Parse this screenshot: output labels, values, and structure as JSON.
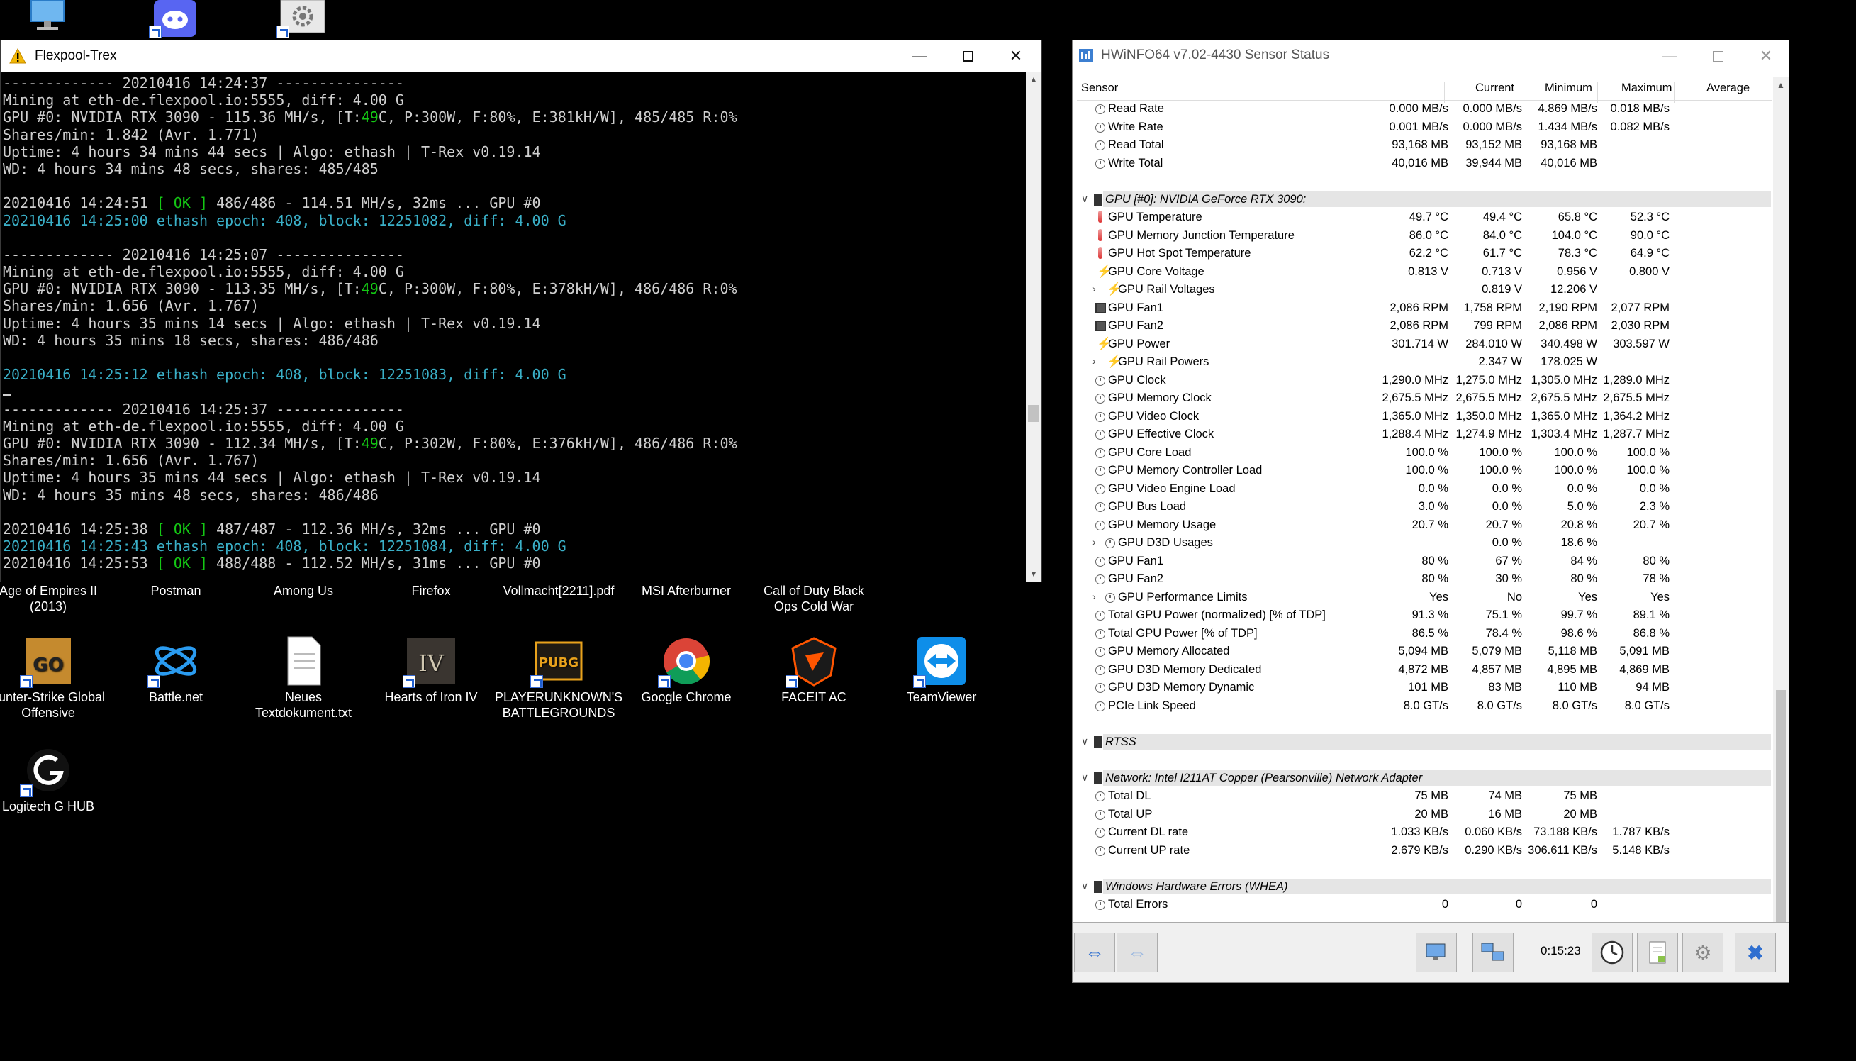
{
  "desktop": {
    "top_icons": [
      {
        "name": "this-pc",
        "icon": "monitor-icon"
      },
      {
        "name": "discord",
        "icon": "discord-icon"
      },
      {
        "name": "settings",
        "icon": "gear-icon"
      }
    ],
    "row1_labels": [
      "Age of Empires II\n(2013)",
      "Postman",
      "Among Us",
      "Firefox",
      "Vollmacht[2211].pdf",
      "MSI Afterburner",
      "Call of Duty Black\nOps Cold War"
    ],
    "row2": [
      {
        "label": "ounter-Strike Global\nOffensive",
        "icon": "csgo-icon"
      },
      {
        "label": "Battle.net",
        "icon": "battlenet-icon"
      },
      {
        "label": "Neues\nTextdokument.txt",
        "icon": "text-document-icon"
      },
      {
        "label": "Hearts of Iron IV",
        "icon": "hoi4-icon"
      },
      {
        "label": "PLAYERUNKNOWN'S\nBATTLEGROUNDS",
        "icon": "pubg-icon"
      },
      {
        "label": "Google Chrome",
        "icon": "chrome-icon"
      },
      {
        "label": "FACEIT AC",
        "icon": "faceit-icon"
      },
      {
        "label": "TeamViewer",
        "icon": "teamviewer-icon"
      }
    ],
    "row3": [
      {
        "label": "Logitech G HUB",
        "icon": "logitech-icon"
      }
    ]
  },
  "console": {
    "title": "Flexpool-Trex",
    "lines": [
      [
        {
          "t": "------------- 20210416 14:24:37 ---------------"
        }
      ],
      [
        {
          "t": "Mining at eth-de.flexpool.io:5555, diff: 4.00 G"
        }
      ],
      [
        {
          "t": "GPU #0: NVIDIA RTX 3090 - 115.36 MH/s, [T:"
        },
        {
          "t": "49",
          "c": "temp"
        },
        {
          "t": "C, P:300W, F:80%, E:381kH/W], 485/485 R:0%"
        }
      ],
      [
        {
          "t": "Shares/min: 1.842 (Avr. 1.771)"
        }
      ],
      [
        {
          "t": "Uptime: 4 hours 34 mins 44 secs | Algo: ethash | T-Rex v0.19.14"
        }
      ],
      [
        {
          "t": "WD: 4 hours 34 mins 48 secs, shares: 485/485"
        }
      ],
      [
        {
          "t": ""
        }
      ],
      [
        {
          "t": "20210416 14:24:51 "
        },
        {
          "t": "[ OK ]",
          "c": "ok"
        },
        {
          "t": " 486/486 - 114.51 MH/s, 32ms ... GPU #0"
        }
      ],
      [
        {
          "t": "20210416 14:25:00 ethash epoch: 408, block: 12251082, diff: 4.00 G",
          "c": "cyan"
        }
      ],
      [
        {
          "t": ""
        }
      ],
      [
        {
          "t": "------------- 20210416 14:25:07 ---------------"
        }
      ],
      [
        {
          "t": "Mining at eth-de.flexpool.io:5555, diff: 4.00 G"
        }
      ],
      [
        {
          "t": "GPU #0: NVIDIA RTX 3090 - 113.35 MH/s, [T:"
        },
        {
          "t": "49",
          "c": "temp"
        },
        {
          "t": "C, P:300W, F:80%, E:378kH/W], 486/486 R:0%"
        }
      ],
      [
        {
          "t": "Shares/min: 1.656 (Avr. 1.767)"
        }
      ],
      [
        {
          "t": "Uptime: 4 hours 35 mins 14 secs | Algo: ethash | T-Rex v0.19.14"
        }
      ],
      [
        {
          "t": "WD: 4 hours 35 mins 18 secs, shares: 486/486"
        }
      ],
      [
        {
          "t": ""
        }
      ],
      [
        {
          "t": "20210416 14:25:12 ethash epoch: 408, block: 12251083, diff: 4.00 G",
          "c": "cyan"
        }
      ],
      [
        {
          "t": "",
          "c": "cursor"
        }
      ],
      [
        {
          "t": "------------- 20210416 14:25:37 ---------------"
        }
      ],
      [
        {
          "t": "Mining at eth-de.flexpool.io:5555, diff: 4.00 G"
        }
      ],
      [
        {
          "t": "GPU #0: NVIDIA RTX 3090 - 112.34 MH/s, [T:"
        },
        {
          "t": "49",
          "c": "temp"
        },
        {
          "t": "C, P:302W, F:80%, E:376kH/W], 486/486 R:0%"
        }
      ],
      [
        {
          "t": "Shares/min: 1.656 (Avr. 1.767)"
        }
      ],
      [
        {
          "t": "Uptime: 4 hours 35 mins 44 secs | Algo: ethash | T-Rex v0.19.14"
        }
      ],
      [
        {
          "t": "WD: 4 hours 35 mins 48 secs, shares: 486/486"
        }
      ],
      [
        {
          "t": ""
        }
      ],
      [
        {
          "t": "20210416 14:25:38 "
        },
        {
          "t": "[ OK ]",
          "c": "ok"
        },
        {
          "t": " 487/487 - 112.36 MH/s, 32ms ... GPU #0"
        }
      ],
      [
        {
          "t": "20210416 14:25:43 ethash epoch: 408, block: 12251084, diff: 4.00 G",
          "c": "cyan"
        }
      ],
      [
        {
          "t": "20210416 14:25:53 "
        },
        {
          "t": "[ OK ]",
          "c": "ok"
        },
        {
          "t": " 488/488 - 112.52 MH/s, 31ms ... GPU #0"
        }
      ],
      [
        {
          "t": "",
          "c": "cursor"
        }
      ]
    ]
  },
  "hwinfo": {
    "title": "HWiNFO64 v7.02-4430 Sensor Status",
    "columns": [
      "Sensor",
      "Current",
      "Minimum",
      "Maximum",
      "Average"
    ],
    "time": "0:15:23",
    "rows": [
      {
        "type": "item",
        "icon": "round",
        "name": "Read Rate",
        "cur": "0.000 MB/s",
        "min": "0.000 MB/s",
        "max": "4.869 MB/s",
        "avg": "0.018 MB/s"
      },
      {
        "type": "item",
        "icon": "round",
        "name": "Write Rate",
        "cur": "0.001 MB/s",
        "min": "0.000 MB/s",
        "max": "1.434 MB/s",
        "avg": "0.082 MB/s"
      },
      {
        "type": "item",
        "icon": "round",
        "name": "Read Total",
        "cur": "93,168 MB",
        "min": "93,152 MB",
        "max": "93,168 MB",
        "avg": ""
      },
      {
        "type": "item",
        "icon": "round",
        "name": "Write Total",
        "cur": "40,016 MB",
        "min": "39,944 MB",
        "max": "40,016 MB",
        "avg": ""
      },
      {
        "type": "blank"
      },
      {
        "type": "group",
        "name": "GPU [#0]: NVIDIA GeForce RTX 3090:"
      },
      {
        "type": "item",
        "icon": "therm",
        "name": "GPU Temperature",
        "cur": "49.7 °C",
        "min": "49.4 °C",
        "max": "65.8 °C",
        "avg": "52.3 °C"
      },
      {
        "type": "item",
        "icon": "therm",
        "name": "GPU Memory Junction Temperature",
        "cur": "86.0 °C",
        "min": "84.0 °C",
        "max": "104.0 °C",
        "avg": "90.0 °C"
      },
      {
        "type": "item",
        "icon": "therm",
        "name": "GPU Hot Spot Temperature",
        "cur": "62.2 °C",
        "min": "61.7 °C",
        "max": "78.3 °C",
        "avg": "64.9 °C"
      },
      {
        "type": "item",
        "icon": "bolt",
        "name": "GPU Core Voltage",
        "cur": "0.813 V",
        "min": "0.713 V",
        "max": "0.956 V",
        "avg": "0.800 V"
      },
      {
        "type": "sub",
        "icon": "bolt",
        "name": "GPU Rail Voltages",
        "cur": "",
        "min": "0.819 V",
        "max": "12.206 V",
        "avg": ""
      },
      {
        "type": "item",
        "icon": "fan",
        "name": "GPU Fan1",
        "cur": "2,086 RPM",
        "min": "1,758 RPM",
        "max": "2,190 RPM",
        "avg": "2,077 RPM"
      },
      {
        "type": "item",
        "icon": "fan",
        "name": "GPU Fan2",
        "cur": "2,086 RPM",
        "min": "799 RPM",
        "max": "2,086 RPM",
        "avg": "2,030 RPM"
      },
      {
        "type": "item",
        "icon": "bolt",
        "name": "GPU Power",
        "cur": "301.714 W",
        "min": "284.010 W",
        "max": "340.498 W",
        "avg": "303.597 W"
      },
      {
        "type": "sub",
        "icon": "bolt",
        "name": "GPU Rail Powers",
        "cur": "",
        "min": "2.347 W",
        "max": "178.025 W",
        "avg": ""
      },
      {
        "type": "item",
        "icon": "round",
        "name": "GPU Clock",
        "cur": "1,290.0 MHz",
        "min": "1,275.0 MHz",
        "max": "1,305.0 MHz",
        "avg": "1,289.0 MHz"
      },
      {
        "type": "item",
        "icon": "round",
        "name": "GPU Memory Clock",
        "cur": "2,675.5 MHz",
        "min": "2,675.5 MHz",
        "max": "2,675.5 MHz",
        "avg": "2,675.5 MHz"
      },
      {
        "type": "item",
        "icon": "round",
        "name": "GPU Video Clock",
        "cur": "1,365.0 MHz",
        "min": "1,350.0 MHz",
        "max": "1,365.0 MHz",
        "avg": "1,364.2 MHz"
      },
      {
        "type": "item",
        "icon": "round",
        "name": "GPU Effective Clock",
        "cur": "1,288.4 MHz",
        "min": "1,274.9 MHz",
        "max": "1,303.4 MHz",
        "avg": "1,287.7 MHz"
      },
      {
        "type": "item",
        "icon": "round",
        "name": "GPU Core Load",
        "cur": "100.0 %",
        "min": "100.0 %",
        "max": "100.0 %",
        "avg": "100.0 %"
      },
      {
        "type": "item",
        "icon": "round",
        "name": "GPU Memory Controller Load",
        "cur": "100.0 %",
        "min": "100.0 %",
        "max": "100.0 %",
        "avg": "100.0 %"
      },
      {
        "type": "item",
        "icon": "round",
        "name": "GPU Video Engine Load",
        "cur": "0.0 %",
        "min": "0.0 %",
        "max": "0.0 %",
        "avg": "0.0 %"
      },
      {
        "type": "item",
        "icon": "round",
        "name": "GPU Bus Load",
        "cur": "3.0 %",
        "min": "0.0 %",
        "max": "5.0 %",
        "avg": "2.3 %"
      },
      {
        "type": "item",
        "icon": "round",
        "name": "GPU Memory Usage",
        "cur": "20.7 %",
        "min": "20.7 %",
        "max": "20.8 %",
        "avg": "20.7 %"
      },
      {
        "type": "sub",
        "icon": "round",
        "name": "GPU D3D Usages",
        "cur": "",
        "min": "0.0 %",
        "max": "18.6 %",
        "avg": ""
      },
      {
        "type": "item",
        "icon": "round",
        "name": "GPU Fan1",
        "cur": "80 %",
        "min": "67 %",
        "max": "84 %",
        "avg": "80 %"
      },
      {
        "type": "item",
        "icon": "round",
        "name": "GPU Fan2",
        "cur": "80 %",
        "min": "30 %",
        "max": "80 %",
        "avg": "78 %"
      },
      {
        "type": "sub",
        "icon": "round",
        "name": "GPU Performance Limits",
        "cur": "Yes",
        "min": "No",
        "max": "Yes",
        "avg": "Yes"
      },
      {
        "type": "item",
        "icon": "round",
        "name": "Total GPU Power (normalized) [% of TDP]",
        "cur": "91.3 %",
        "min": "75.1 %",
        "max": "99.7 %",
        "avg": "89.1 %"
      },
      {
        "type": "item",
        "icon": "round",
        "name": "Total GPU Power [% of TDP]",
        "cur": "86.5 %",
        "min": "78.4 %",
        "max": "98.6 %",
        "avg": "86.8 %"
      },
      {
        "type": "item",
        "icon": "round",
        "name": "GPU Memory Allocated",
        "cur": "5,094 MB",
        "min": "5,079 MB",
        "max": "5,118 MB",
        "avg": "5,091 MB"
      },
      {
        "type": "item",
        "icon": "round",
        "name": "GPU D3D Memory Dedicated",
        "cur": "4,872 MB",
        "min": "4,857 MB",
        "max": "4,895 MB",
        "avg": "4,869 MB"
      },
      {
        "type": "item",
        "icon": "round",
        "name": "GPU D3D Memory Dynamic",
        "cur": "101 MB",
        "min": "83 MB",
        "max": "110 MB",
        "avg": "94 MB"
      },
      {
        "type": "item",
        "icon": "round",
        "name": "PCIe Link Speed",
        "cur": "8.0 GT/s",
        "min": "8.0 GT/s",
        "max": "8.0 GT/s",
        "avg": "8.0 GT/s"
      },
      {
        "type": "blank"
      },
      {
        "type": "group",
        "name": "RTSS"
      },
      {
        "type": "blank"
      },
      {
        "type": "group",
        "name": "Network: Intel I211AT Copper (Pearsonville) Network Adapter"
      },
      {
        "type": "item",
        "icon": "round",
        "name": "Total DL",
        "cur": "75 MB",
        "min": "74 MB",
        "max": "75 MB",
        "avg": ""
      },
      {
        "type": "item",
        "icon": "round",
        "name": "Total UP",
        "cur": "20 MB",
        "min": "16 MB",
        "max": "20 MB",
        "avg": ""
      },
      {
        "type": "item",
        "icon": "round",
        "name": "Current DL rate",
        "cur": "1.033 KB/s",
        "min": "0.060 KB/s",
        "max": "73.188 KB/s",
        "avg": "1.787 KB/s"
      },
      {
        "type": "item",
        "icon": "round",
        "name": "Current UP rate",
        "cur": "2.679 KB/s",
        "min": "0.290 KB/s",
        "max": "306.611 KB/s",
        "avg": "5.148 KB/s"
      },
      {
        "type": "blank"
      },
      {
        "type": "group",
        "name": "Windows Hardware Errors (WHEA)"
      },
      {
        "type": "item",
        "icon": "round",
        "name": "Total Errors",
        "cur": "0",
        "min": "0",
        "max": "0",
        "avg": ""
      }
    ]
  }
}
